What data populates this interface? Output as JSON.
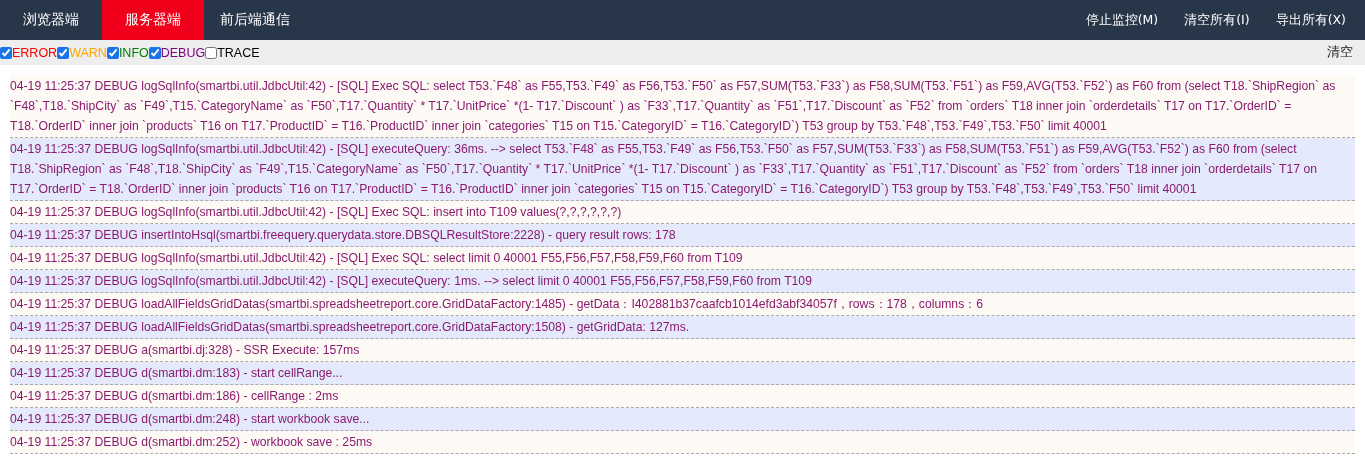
{
  "tabs": [
    {
      "label": "浏览器端",
      "selected": false
    },
    {
      "label": "服务器端",
      "selected": true
    },
    {
      "label": "前后端通信",
      "selected": false
    }
  ],
  "toolbar_actions": [
    "停止监控(M)",
    "清空所有(I)",
    "导出所有(X)"
  ],
  "filters": [
    {
      "label": "ERROR",
      "checked": true,
      "color": "#ff0000"
    },
    {
      "label": "WARN",
      "checked": true,
      "color": "#ffa500"
    },
    {
      "label": "INFO",
      "checked": true,
      "color": "#008000"
    },
    {
      "label": "DEBUG",
      "checked": true,
      "color": "#800080"
    },
    {
      "label": "TRACE",
      "checked": false,
      "color": "#000000"
    }
  ],
  "clear_button": "清空",
  "log_entries": [
    "04-19 11:25:37 DEBUG logSqlInfo(smartbi.util.JdbcUtil:42) - [SQL] Exec SQL: select T53.`F48` as F55,T53.`F49` as F56,T53.`F50` as F57,SUM(T53.`F33`) as F58,SUM(T53.`F51`) as F59,AVG(T53.`F52`) as F60 from (select T18.`ShipRegion` as `F48`,T18.`ShipCity` as `F49`,T15.`CategoryName` as `F50`,T17.`Quantity` * T17.`UnitPrice` *(1- T17.`Discount` ) as `F33`,T17.`Quantity` as `F51`,T17.`Discount` as `F52` from `orders` T18 inner join `orderdetails` T17 on T17.`OrderID` = T18.`OrderID` inner join `products` T16 on T17.`ProductID` = T16.`ProductID` inner join `categories` T15 on T15.`CategoryID` = T16.`CategoryID`) T53 group by T53.`F48`,T53.`F49`,T53.`F50` limit 40001",
    "04-19 11:25:37 DEBUG logSqlInfo(smartbi.util.JdbcUtil:42) - [SQL] executeQuery: 36ms. --> select T53.`F48` as F55,T53.`F49` as F56,T53.`F50` as F57,SUM(T53.`F33`) as F58,SUM(T53.`F51`) as F59,AVG(T53.`F52`) as F60 from (select T18.`ShipRegion` as `F48`,T18.`ShipCity` as `F49`,T15.`CategoryName` as `F50`,T17.`Quantity` * T17.`UnitPrice` *(1- T17.`Discount` ) as `F33`,T17.`Quantity` as `F51`,T17.`Discount` as `F52` from `orders` T18 inner join `orderdetails` T17 on T17.`OrderID` = T18.`OrderID` inner join `products` T16 on T17.`ProductID` = T16.`ProductID` inner join `categories` T15 on T15.`CategoryID` = T16.`CategoryID`) T53 group by T53.`F48`,T53.`F49`,T53.`F50` limit 40001",
    "04-19 11:25:37 DEBUG logSqlInfo(smartbi.util.JdbcUtil:42) - [SQL] Exec SQL: insert into T109 values(?,?,?,?,?,?)",
    "04-19 11:25:37 DEBUG insertIntoHsql(smartbi.freequery.querydata.store.DBSQLResultStore:2228) - query result rows: 178",
    "04-19 11:25:37 DEBUG logSqlInfo(smartbi.util.JdbcUtil:42) - [SQL] Exec SQL: select limit 0 40001 F55,F56,F57,F58,F59,F60 from T109",
    "04-19 11:25:37 DEBUG logSqlInfo(smartbi.util.JdbcUtil:42) - [SQL] executeQuery: 1ms. --> select limit 0 40001 F55,F56,F57,F58,F59,F60 from T109",
    "04-19 11:25:37 DEBUG loadAllFieldsGridDatas(smartbi.spreadsheetreport.core.GridDataFactory:1485) - getData：I402881b37caafcb1014efd3abf34057f，rows：178，columns：6",
    "04-19 11:25:37 DEBUG loadAllFieldsGridDatas(smartbi.spreadsheetreport.core.GridDataFactory:1508) - getGridData: 127ms.",
    "04-19 11:25:37 DEBUG a(smartbi.dj:328) - SSR Execute: 157ms",
    "04-19 11:25:37 DEBUG d(smartbi.dm:183) - start cellRange...",
    "04-19 11:25:37 DEBUG d(smartbi.dm:186) - cellRange : 2ms",
    "04-19 11:25:37 DEBUG d(smartbi.dm:248) - start workbook save...",
    "04-19 11:25:37 DEBUG d(smartbi.dm:252) - workbook save : 25ms"
  ]
}
